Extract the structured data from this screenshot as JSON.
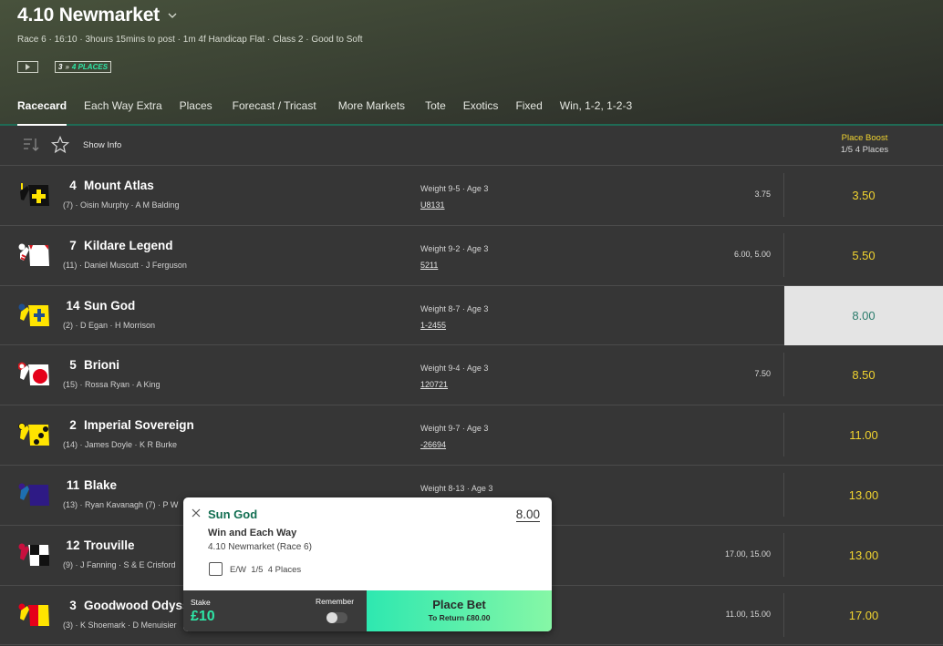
{
  "header": {
    "title": "4.10 Newmarket",
    "subtitle": "Race 6 · 16:10 · 3hours 15mins to post · 1m 4f Handicap Flat · Class 2 · Good to Soft",
    "places_badge": {
      "number": "3",
      "arrows": "»",
      "label": "4 PLACES"
    }
  },
  "tabs": [
    {
      "label": "Racecard",
      "active": true
    },
    {
      "label": "Each Way Extra"
    },
    {
      "label": "Places"
    },
    {
      "label": "Forecast / Tricast"
    },
    {
      "label": "More Markets"
    },
    {
      "label": "Tote"
    },
    {
      "label": "Exotics"
    },
    {
      "label": "Fixed"
    },
    {
      "label": "Win, 1-2, 1-2-3"
    }
  ],
  "toolbar": {
    "show_info": "Show Info",
    "boost_title": "Place Boost",
    "boost_sub": "1/5 4 Places"
  },
  "colors": {
    "odds": "#f1d430",
    "accent_green": "#2ee6a6",
    "selected_odds_text": "#2a7b6b",
    "selection_name": "#126e51"
  },
  "runners": [
    {
      "number": "4",
      "name": "Mount Atlas",
      "draw": "(7)",
      "jockey": "Oisin Murphy",
      "trainer": "A M Balding",
      "weight": "Weight 9-5",
      "age": "Age 3",
      "form": "U8131",
      "previous": "3.75",
      "odds": "3.50",
      "silk": "black-yellow-cross"
    },
    {
      "number": "7",
      "name": "Kildare Legend",
      "draw": "(11)",
      "jockey": "Daniel Muscutt",
      "trainer": "J Ferguson",
      "weight": "Weight 9-2",
      "age": "Age 3",
      "form": "5211",
      "previous": "6.00, 5.00",
      "odds": "5.50",
      "silk": "white-red-hoops"
    },
    {
      "number": "14",
      "name": "Sun God",
      "draw": "(2)",
      "jockey": "D Egan",
      "trainer": "H Morrison",
      "weight": "Weight 8-7",
      "age": "Age 3",
      "form": "1-2455",
      "previous": "",
      "odds": "8.00",
      "selected": true,
      "silk": "yellow-blue-cross"
    },
    {
      "number": "5",
      "name": "Brioni",
      "draw": "(15)",
      "jockey": "Rossa Ryan",
      "trainer": "A King",
      "weight": "Weight 9-4",
      "age": "Age 3",
      "form": "120721",
      "previous": "7.50",
      "odds": "8.50",
      "silk": "white-red-disc"
    },
    {
      "number": "2",
      "name": "Imperial Sovereign",
      "draw": "(14)",
      "jockey": "James Doyle",
      "trainer": "K R Burke",
      "weight": "Weight 9-7",
      "age": "Age 3",
      "form": "-26694",
      "previous": "",
      "odds": "11.00",
      "silk": "yellow-black-spots"
    },
    {
      "number": "11",
      "name": "Blake",
      "draw": "(13)",
      "jockey": "Ryan Kavanagh (7)",
      "trainer": "P W",
      "weight": "Weight 8-13",
      "age": "Age 3",
      "form": "",
      "previous": "",
      "odds": "13.00",
      "silk": "purple-blue"
    },
    {
      "number": "12",
      "name": "Trouville",
      "draw": "(9)",
      "jockey": "J Fanning",
      "trainer": "S & E Crisford",
      "weight": "",
      "age": "",
      "form": "",
      "previous": "17.00, 15.00",
      "odds": "13.00",
      "silk": "black-white-check"
    },
    {
      "number": "3",
      "name": "Goodwood Odyssey",
      "draw": "(3)",
      "jockey": "K Shoemark",
      "trainer": "D Menuisier",
      "weight": "",
      "age": "",
      "form": "",
      "previous": "11.00, 15.00",
      "odds": "17.00",
      "silk": "red-yellow-halves"
    }
  ],
  "betslip": {
    "selection": "Sun God",
    "odds": "8.00",
    "market": "Win and Each Way",
    "event": "4.10 Newmarket (Race 6)",
    "ew_label": "E/W  1/5  4 Places",
    "ew_checked": false,
    "stake_label": "Stake",
    "stake_value": "£10",
    "remember_label": "Remember",
    "remember_on": false,
    "place_bet_label": "Place Bet",
    "to_return": "To Return £80.00"
  }
}
